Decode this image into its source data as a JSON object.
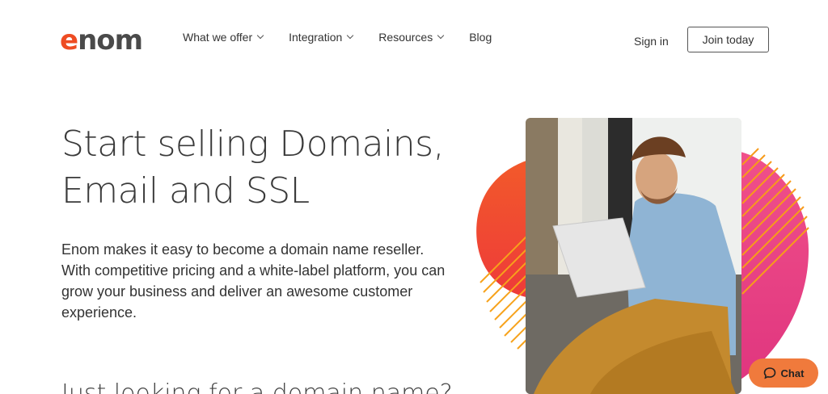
{
  "brand": {
    "logo_e": "e",
    "logo_rest": "nom",
    "accent": "#ee4c23"
  },
  "nav": {
    "items": [
      {
        "label": "What we offer",
        "has_dropdown": true
      },
      {
        "label": "Integration",
        "has_dropdown": true
      },
      {
        "label": "Resources",
        "has_dropdown": true
      },
      {
        "label": "Blog",
        "has_dropdown": false
      }
    ],
    "signin": "Sign in",
    "join": "Join today"
  },
  "hero": {
    "title_line1": "Start selling Domains,",
    "title_line2": "Email and SSL",
    "description": "Enom makes it easy to become a domain name reseller. With competitive pricing and a white-label platform, you can grow your business and deliver an awesome customer experience.",
    "subheading": "Just looking for a domain name?"
  },
  "chat": {
    "label": "Chat",
    "color": "#f07a3c"
  },
  "icons": {
    "chat": "chat-bubble-icon",
    "dropdown": "chevron-down-icon",
    "photo": "man-with-laptop-photo"
  }
}
